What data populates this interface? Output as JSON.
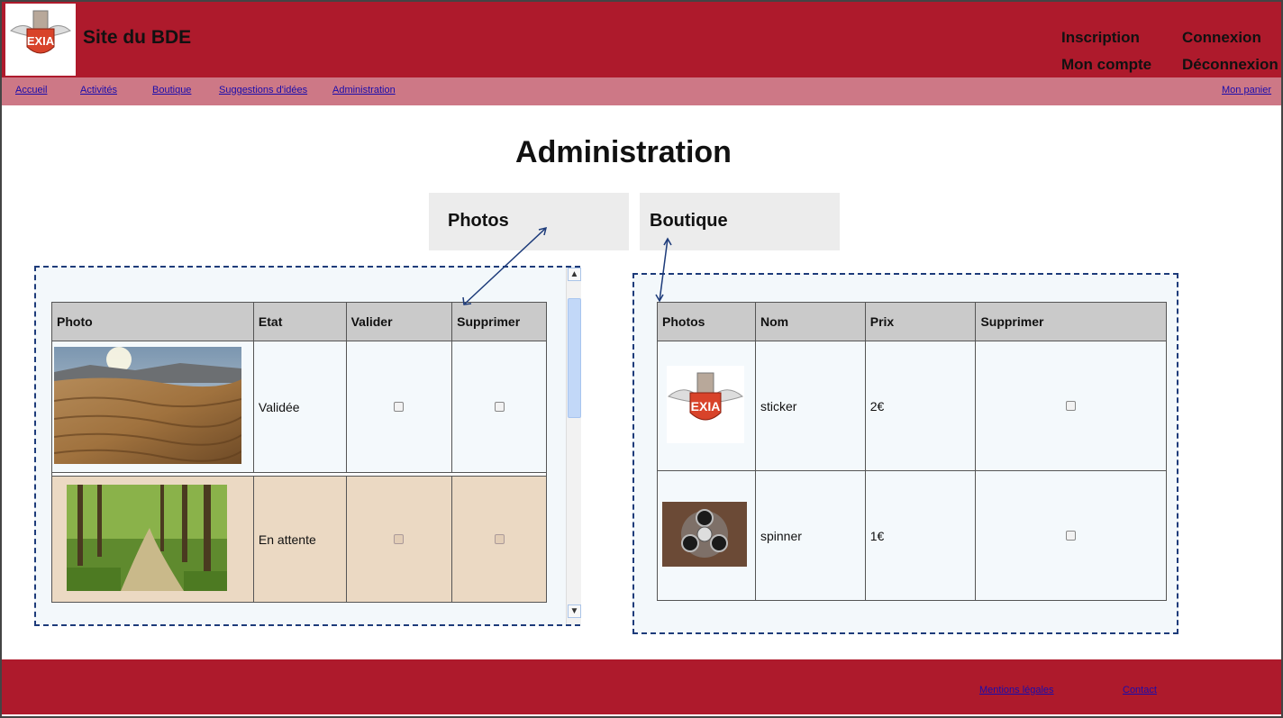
{
  "header": {
    "site_title": "Site du BDE",
    "logo_text": "EXIA",
    "links": {
      "inscription": "Inscription",
      "connexion": "Connexion",
      "mon_compte": "Mon compte",
      "deconnexion": "Déconnexion"
    }
  },
  "nav": {
    "items": [
      "Accueil",
      "Activités",
      "Boutique",
      "Suggestions d'idées",
      "Administration"
    ],
    "cart": "Mon panier"
  },
  "page": {
    "title": "Administration",
    "tabs": [
      "Photos",
      "Boutique"
    ]
  },
  "photos_table": {
    "headers": [
      "Photo",
      "Etat",
      "Valider",
      "Supprimer"
    ],
    "rows": [
      {
        "image": "desert-dunes",
        "etat": "Validée"
      },
      {
        "image": "forest-path",
        "etat": "En attente"
      }
    ]
  },
  "shop_table": {
    "headers": [
      "Photos",
      "Nom",
      "Prix",
      "Supprimer"
    ],
    "rows": [
      {
        "image": "exia-sticker",
        "nom": "sticker",
        "prix": "2€"
      },
      {
        "image": "fidget-spinner",
        "nom": "spinner",
        "prix": "1€"
      }
    ]
  },
  "footer": {
    "mentions": "Mentions légales",
    "contact": "Contact"
  },
  "colors": {
    "header": "#ae1a2c",
    "nav": "#cd7886",
    "link": "#1a0dab",
    "panel_border": "#1d3b7a"
  }
}
